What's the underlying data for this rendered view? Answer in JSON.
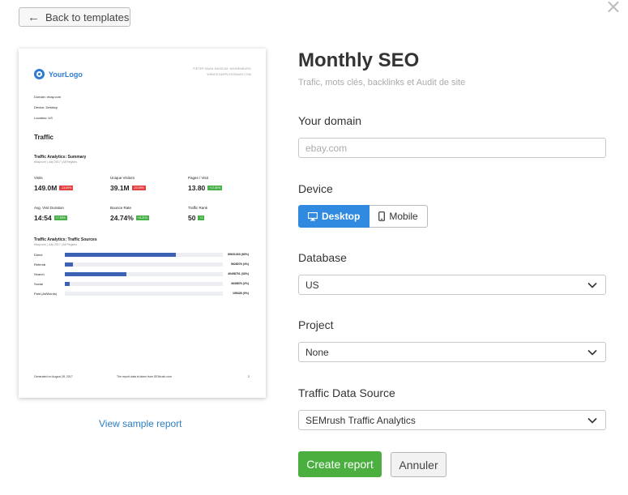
{
  "nav": {
    "back_label": "Back to templates",
    "close_symbol": "×"
  },
  "preview": {
    "logo_text": "YourLogo",
    "address_line1": "PIETER BAAN MUSEUM, WINNENBURG",
    "address_line2": "WWW.EXAMPLEDOMAIN.COM",
    "domain": "Domain: ebay.com",
    "device": "Device: Desktop",
    "location": "Location: US",
    "section_title": "Traffic",
    "summary_title": "Traffic Analytics: Summary",
    "summary_sub": "ebay.com | July 2017 | All Regions",
    "metrics": [
      {
        "label": "Visits",
        "value": "149.0M",
        "change": "-15.69%",
        "trend": "down"
      },
      {
        "label": "Unique Visitors",
        "value": "39.1M",
        "change": "-20.59%",
        "trend": "down"
      },
      {
        "label": "Pages / Visit",
        "value": "13.80",
        "change": "+17.80%",
        "trend": "up"
      },
      {
        "label": "Avg. Visit Duration",
        "value": "14:54",
        "change": "+7.59%",
        "trend": "up"
      },
      {
        "label": "Bounce Rate",
        "value": "24.74%",
        "change": "+6.21%",
        "trend": "up"
      },
      {
        "label": "Traffic Rank",
        "value": "50",
        "change": "+1",
        "trend": "up"
      }
    ],
    "sources_title": "Traffic Analytics: Traffic Sources",
    "sources_sub": "ebay.com | July 2017 | All Regions",
    "sources": [
      {
        "label": "Direct",
        "value": "89631303 (60%)",
        "share": 0.7
      },
      {
        "label": "Referral",
        "value": "5628076 (4%)",
        "share": 0.05
      },
      {
        "label": "Search",
        "value": "49498751 (33%)",
        "share": 0.39
      },
      {
        "label": "Social",
        "value": "3645876 (2%)",
        "share": 0.03
      },
      {
        "label": "Paid (AdWords)",
        "value": "195428 (0%)",
        "share": 0.0
      }
    ],
    "footer_left": "Generated on August 28, 2017",
    "footer_mid": "The report data is taken from SEMrush.com",
    "footer_page": "2",
    "sample_link": "View sample report"
  },
  "form": {
    "title": "Monthly SEO",
    "subtitle": "Trafic, mots clés, backlinks et Audit de site",
    "domain_label": "Your domain",
    "domain_placeholder": "ebay.com",
    "device_label": "Device",
    "device_desktop": "Desktop",
    "device_mobile": "Mobile",
    "database_label": "Database",
    "database_value": "US",
    "project_label": "Project",
    "project_value": "None",
    "source_label": "Traffic Data Source",
    "source_value": "SEMrush Traffic Analytics",
    "create_label": "Create report",
    "cancel_label": "Annuler"
  },
  "colors": {
    "accent": "#2f8ae0",
    "create": "#4aaf3f",
    "link": "#2b7fc2",
    "bar": "#3d62b4"
  }
}
